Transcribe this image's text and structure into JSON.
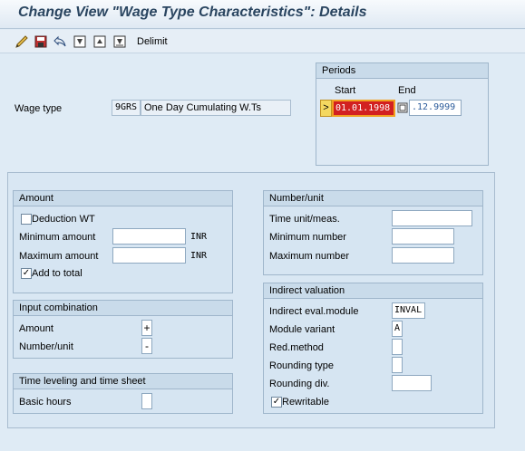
{
  "title": "Change View \"Wage Type Characteristics\": Details",
  "toolbar": {
    "icons": [
      "change-display-icon",
      "save-icon",
      "undo-icon",
      "first-entry-icon",
      "previous-entry-icon",
      "next-entry-icon"
    ],
    "delimit_label": "Delimit"
  },
  "wage_type": {
    "label": "Wage type",
    "code": "9GRS",
    "description": "One Day Cumulating W.Ts"
  },
  "periods": {
    "title": "Periods",
    "start_label": "Start",
    "end_label": "End",
    "start_value": "01.01.1998",
    "end_value": ".12.9999",
    "marker": ">"
  },
  "amount": {
    "title": "Amount",
    "deduction_label": "Deduction WT",
    "deduction_checked": false,
    "min_label": "Minimum amount",
    "min_value": "",
    "max_label": "Maximum amount",
    "max_value": "",
    "currency": "INR",
    "add_total_label": "Add to total",
    "add_total_checked": true
  },
  "input_combination": {
    "title": "Input combination",
    "amount_label": "Amount",
    "amount_value": "+",
    "number_label": "Number/unit",
    "number_value": "-"
  },
  "time_leveling": {
    "title": "Time leveling and time sheet",
    "basic_hours_label": "Basic hours",
    "basic_hours_value": ""
  },
  "number_unit": {
    "title": "Number/unit",
    "time_unit_label": "Time unit/meas.",
    "time_unit_value": "",
    "min_label": "Minimum number",
    "min_value": "",
    "max_label": "Maximum number",
    "max_value": ""
  },
  "indirect": {
    "title": "Indirect valuation",
    "module_label": "Indirect eval.module",
    "module_value": "INVAL",
    "variant_label": "Module variant",
    "variant_value": "A",
    "red_label": "Red.method",
    "red_value": "",
    "rounding_type_label": "Rounding type",
    "rounding_type_value": "",
    "rounding_div_label": "Rounding div.",
    "rounding_div_value": "",
    "rewritable_label": "Rewritable",
    "rewritable_checked": true
  },
  "colors": {
    "background": "#dfebf5",
    "title_text": "#2a4560",
    "group_bg": "#d6e5f2",
    "field_error_bg": "#d22020",
    "field_error_border": "#f2a020"
  }
}
